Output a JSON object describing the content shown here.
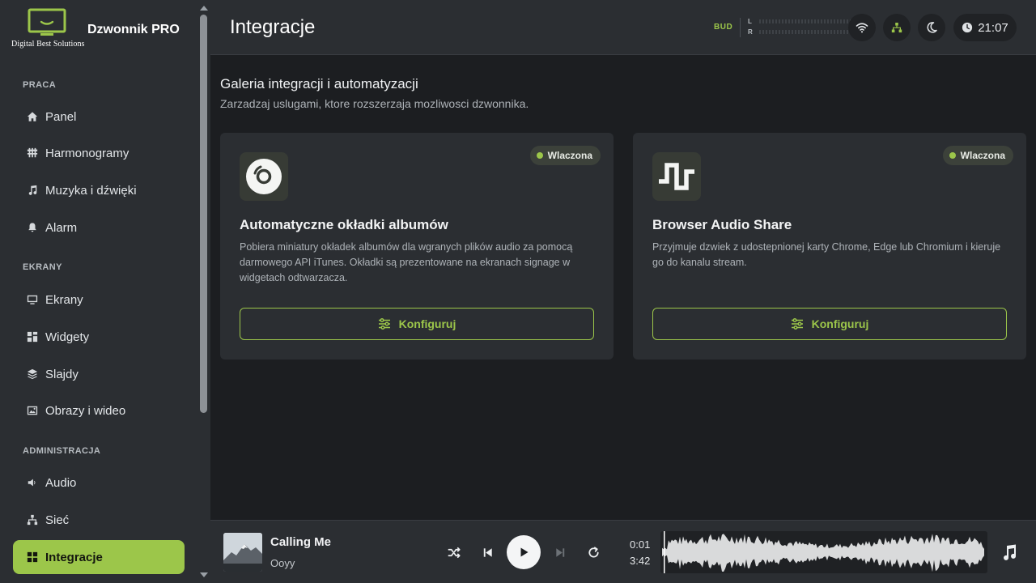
{
  "brand": {
    "logo_text": "Digital Best Solutions",
    "app_name": "Dzwonnik PRO",
    "accent": "#9cc64a"
  },
  "sidebar": {
    "sections": [
      {
        "label": "PRACA",
        "items": [
          {
            "label": "Panel",
            "icon": "home-icon"
          },
          {
            "label": "Harmonogramy",
            "icon": "schedule-icon"
          },
          {
            "label": "Muzyka i dźwięki",
            "icon": "music-note-icon"
          },
          {
            "label": "Alarm",
            "icon": "bell-icon"
          }
        ]
      },
      {
        "label": "EKRANY",
        "items": [
          {
            "label": "Ekrany",
            "icon": "monitor-icon"
          },
          {
            "label": "Widgety",
            "icon": "widgets-icon"
          },
          {
            "label": "Slajdy",
            "icon": "layers-icon"
          },
          {
            "label": "Obrazy i wideo",
            "icon": "image-icon"
          }
        ]
      },
      {
        "label": "ADMINISTRACJA",
        "items": [
          {
            "label": "Audio",
            "icon": "speaker-icon"
          },
          {
            "label": "Sieć",
            "icon": "network-icon"
          },
          {
            "label": "Integracje",
            "icon": "grid-icon",
            "active": true
          }
        ]
      }
    ]
  },
  "header": {
    "title": "Integracje",
    "bud_label": "BUD",
    "meter_left": "L",
    "meter_right": "R",
    "time": "21:07",
    "buttons": [
      "wifi-icon",
      "network-icon",
      "moon-icon"
    ]
  },
  "main": {
    "title": "Galeria integracji i automatyzacji",
    "subtitle": "Zarzadzaj uslugami, ktore rozszerzaja mozliwosci dzwonnika.",
    "cards": [
      {
        "icon": "vinyl-disc-icon",
        "status": "Wlaczona",
        "title": "Automatyczne okładki albumów",
        "description": "Pobiera miniatury okładek albumów dla wgranych plików audio za pomocą darmowego API iTunes. Okładki są prezentowane na ekranach signage w widgetach odtwarzacza.",
        "button": "Konfiguruj"
      },
      {
        "icon": "waveform-square-icon",
        "status": "Wlaczona",
        "title": "Browser Audio Share",
        "description": "Przyjmuje dzwiek z udostepnionej karty Chrome, Edge lub Chromium i kieruje go do kanalu stream.",
        "button": "Konfiguruj"
      }
    ]
  },
  "player": {
    "track_title": "Calling Me",
    "artist": "Ooyy",
    "time_current": "0:01",
    "time_total": "3:42",
    "progress_fraction": 0.005
  }
}
